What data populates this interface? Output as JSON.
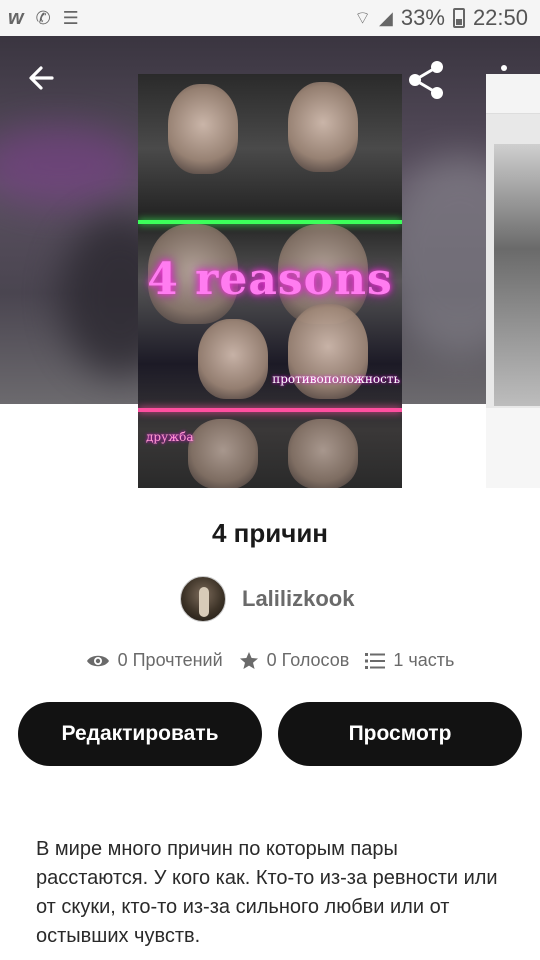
{
  "status_bar": {
    "battery": "33%",
    "time": "22:50"
  },
  "cover": {
    "title": "4 reasons",
    "caption_top": "",
    "caption_mid": "",
    "caption_opposites": "противоположность",
    "caption_friendship": "дружба"
  },
  "story": {
    "title": "4 причин",
    "author": "Lalilizkook",
    "stats": {
      "reads": "0 Прочтений",
      "votes": "0 Голосов",
      "parts": "1 часть"
    },
    "buttons": {
      "edit": "Редактировать",
      "preview": "Просмотр"
    },
    "description": "В мире много причин по которым пары расстаются. У кого как. Кто-то из-за ревности или от скуки, кто-то из-за сильного любви или от остывших чувств."
  },
  "icons": {
    "back": "arrow-left-icon",
    "share": "share-icon",
    "more": "more-vertical-icon",
    "reads": "eye-icon",
    "votes": "star-icon",
    "parts": "list-icon"
  }
}
